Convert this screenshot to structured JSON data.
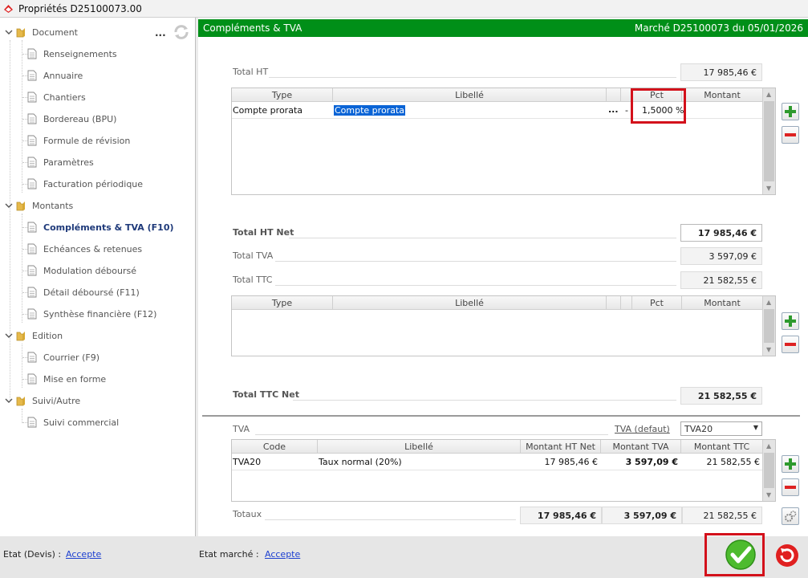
{
  "window": {
    "title": "Propriétés D25100073.00"
  },
  "tree": {
    "more": "...",
    "groups": [
      {
        "label": "Document",
        "items": [
          "Renseignements",
          "Annuaire",
          "Chantiers",
          "Bordereau (BPU)",
          "Formule de révision",
          "Paramètres",
          "Facturation périodique"
        ]
      },
      {
        "label": "Montants",
        "items": [
          "Compléments & TVA (F10)",
          "Echéances & retenues",
          "Modulation déboursé",
          "Détail déboursé (F11)",
          "Synthèse financière (F12)"
        ]
      },
      {
        "label": "Edition",
        "items": [
          "Courrier (F9)",
          "Mise en forme"
        ]
      },
      {
        "label": "Suivi/Autre",
        "items": [
          "Suivi commercial"
        ]
      }
    ],
    "active": "Compléments & TVA (F10)"
  },
  "header": {
    "title": "Compléments & TVA",
    "market": "Marché D25100073 du 05/01/2026"
  },
  "totals": {
    "total_ht_label": "Total HT",
    "total_ht": "17 985,46 €",
    "total_ht_net_label": "Total HT Net",
    "total_ht_net": "17 985,46 €",
    "total_tva_label": "Total TVA",
    "total_tva": "3 597,09 €",
    "total_ttc_label": "Total TTC",
    "total_ttc": "21 582,55 €",
    "total_ttc_net_label": "Total TTC Net",
    "total_ttc_net": "21 582,55 €"
  },
  "grid1": {
    "columns": {
      "type": "Type",
      "libelle": "Libellé",
      "pct": "Pct",
      "montant": "Montant"
    },
    "rows": [
      {
        "type": "Compte prorata",
        "libelle": "Compte prorata",
        "dots": "...",
        "dash": "-",
        "pct": "1,5000 %",
        "montant": ""
      }
    ]
  },
  "grid2": {
    "columns": {
      "type": "Type",
      "libelle": "Libellé",
      "pct": "Pct",
      "montant": "Montant"
    },
    "rows": []
  },
  "tva": {
    "label": "TVA",
    "default_link": "TVA (defaut)",
    "default_value": "TVA20",
    "columns": {
      "code": "Code",
      "libelle": "Libellé",
      "ht": "Montant HT Net",
      "tva": "Montant TVA",
      "ttc": "Montant TTC"
    },
    "rows": [
      {
        "code": "TVA20",
        "libelle": "Taux normal (20%)",
        "ht": "17 985,46 €",
        "tva": "3 597,09 €",
        "ttc": "21 582,55 €"
      }
    ],
    "totaux_label": "Totaux",
    "totaux": {
      "ht": "17 985,46 €",
      "tva": "3 597,09 €",
      "ttc": "21 582,55 €"
    }
  },
  "status": {
    "etat_devis_label": "Etat (Devis) :",
    "etat_devis": "Accepte",
    "etat_marche_label": "Etat marché :",
    "etat_marche": "Accepte"
  },
  "colors": {
    "green": "#008f18",
    "red_highlight": "#d3111b",
    "link": "#1c3fd0"
  }
}
